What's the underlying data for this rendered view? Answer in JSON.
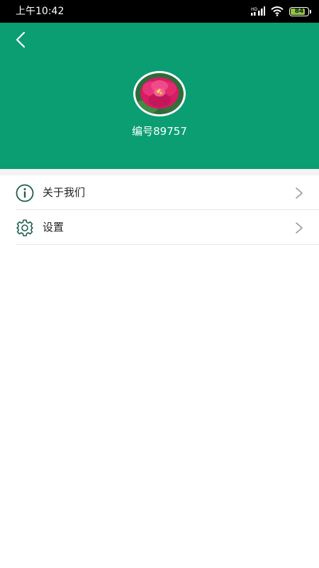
{
  "status_bar": {
    "time": "上午10:42",
    "battery_level": "84"
  },
  "header": {
    "user_id": "编号89757",
    "avatar": "peony-flower-image",
    "background_color": "#0a9e72"
  },
  "menu": {
    "items": [
      {
        "label": "关于我们",
        "icon": "info-icon"
      },
      {
        "label": "设置",
        "icon": "gear-icon"
      }
    ]
  }
}
